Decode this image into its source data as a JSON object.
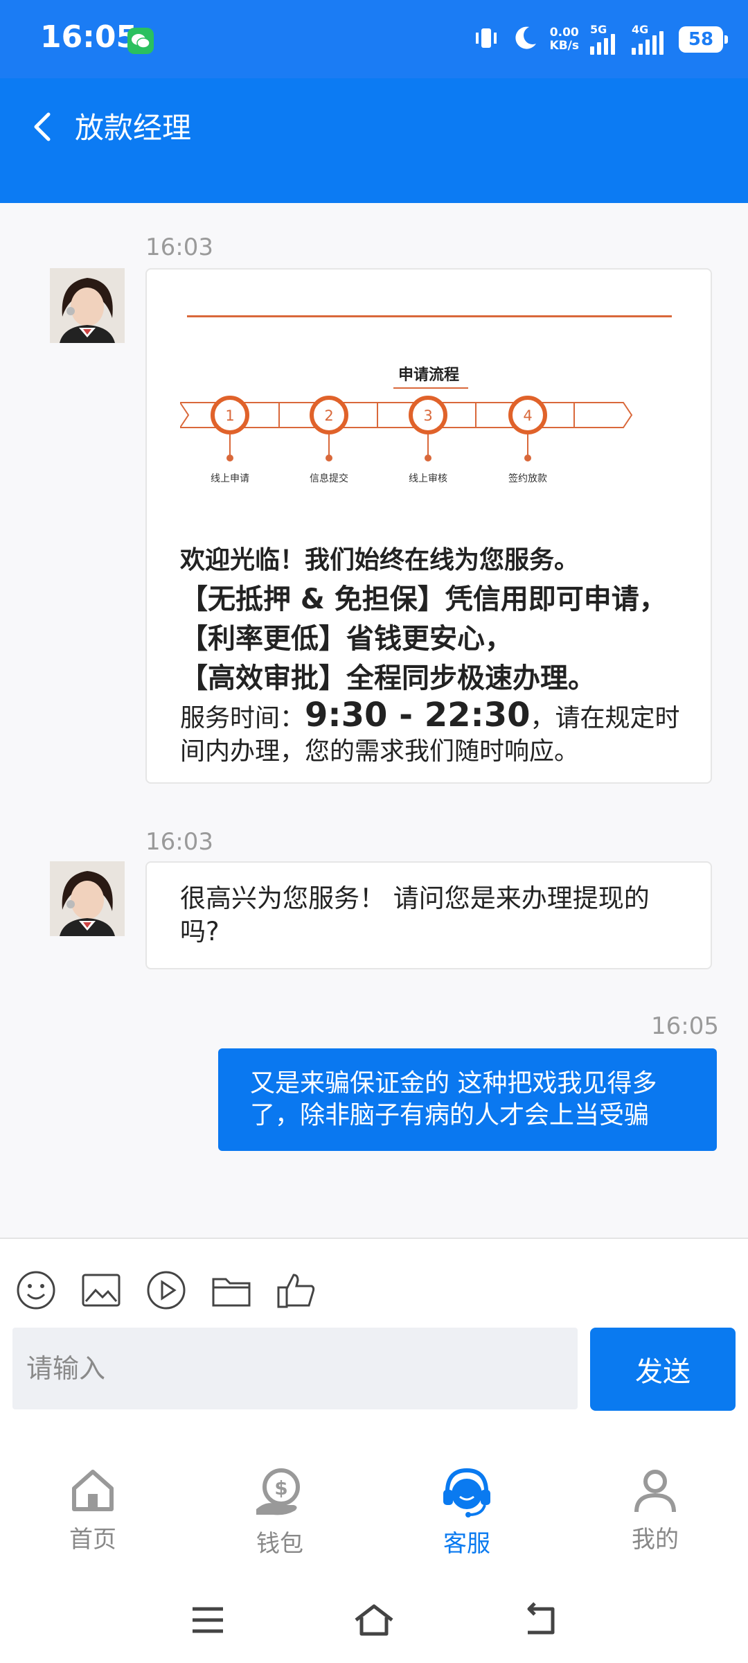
{
  "status_bar": {
    "time": "16:05",
    "net_speed_value": "0.00",
    "net_speed_unit": "KB/s",
    "sim1_label": "5G",
    "sim2_label": "4G",
    "battery": "58"
  },
  "header": {
    "title": "放款经理"
  },
  "chat": {
    "messages": [
      {
        "time": "16:03",
        "flow": {
          "title": "申请流程",
          "steps": [
            {
              "num": "1",
              "label": "线上申请"
            },
            {
              "num": "2",
              "label": "信息提交"
            },
            {
              "num": "3",
              "label": "线上审核"
            },
            {
              "num": "4",
              "label": "签约放款"
            }
          ]
        },
        "line1": "欢迎光临！我们始终在线为您服务。",
        "line2": "【无抵押 & 免担保】凭信用即可申请，【利率更低】省钱更安心，",
        "line3": "【高效审批】全程同步极速办理。",
        "hours_prefix": "服务时间：",
        "hours": "9:30 - 22:30",
        "hours_suffix": "，请在规定时间内办理，您的需求我们随时响应。"
      },
      {
        "time": "16:03",
        "text": "很高兴为您服务！ 请问您是来办理提现的吗?"
      },
      {
        "time": "16:05",
        "text": "又是来骗保证金的 这种把戏我见得多了，除非脑子有病的人才会上当受骗"
      }
    ]
  },
  "composer": {
    "placeholder": "请输入",
    "send_label": "发送",
    "tools": [
      "emoji-icon",
      "image-icon",
      "video-icon",
      "folder-icon",
      "thumbs-up-icon"
    ]
  },
  "bottom_nav": {
    "items": [
      {
        "label": "首页",
        "icon": "home-icon"
      },
      {
        "label": "钱包",
        "icon": "wallet-icon"
      },
      {
        "label": "客服",
        "icon": "customer-service-icon",
        "active": true
      },
      {
        "label": "我的",
        "icon": "profile-icon"
      }
    ]
  },
  "colors": {
    "primary": "#0a7af0",
    "flow_accent": "#d9683a"
  }
}
